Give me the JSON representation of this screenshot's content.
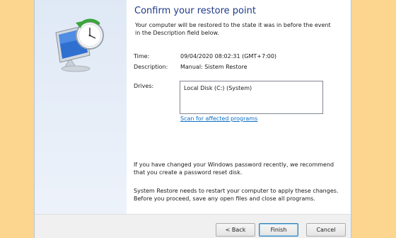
{
  "wizard": {
    "title": "Confirm your restore point",
    "intro": "Your computer will be restored to the state it was in before the event in the Description field below."
  },
  "details": {
    "time_label": "Time:",
    "time_value": "09/04/2020 08:02:31 (GMT+7:00)",
    "description_label": "Description:",
    "description_value": "Manual: Sistem Restore",
    "drives_label": "Drives:",
    "drives": [
      "Local Disk (C:) (System)"
    ],
    "scan_link": "Scan for affected programs"
  },
  "notes": {
    "password": "If you have changed your Windows password recently, we recommend that you create a password reset disk.",
    "restart": "System Restore needs to restart your computer to apply these changes. Before you proceed, save any open files and close all programs."
  },
  "buttons": {
    "back": "< Back",
    "finish": "Finish",
    "cancel": "Cancel"
  },
  "icons": {
    "app": "system-restore-icon"
  },
  "colors": {
    "desktop": "#fcd68f",
    "title": "#1e3a8a",
    "link": "#0a6ec4",
    "side_panel": "#dfe9f5"
  }
}
